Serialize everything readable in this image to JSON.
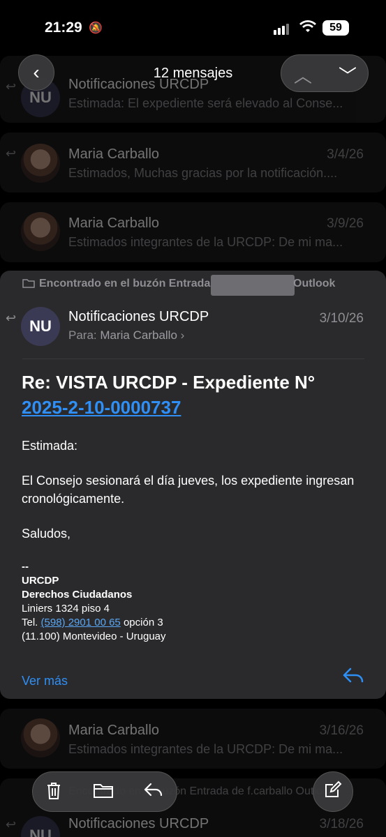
{
  "status_bar": {
    "time": "21:29",
    "battery": "59"
  },
  "nav": {
    "title": "12 mensajes"
  },
  "messages_above": [
    {
      "sender": "Notificaciones URCDP",
      "initials": "NU",
      "preview": "Estimada: El expediente será elevado al Conse...",
      "date": ""
    },
    {
      "sender": "Maria Carballo",
      "preview": "Estimados, Muchas gracias por la notificación....",
      "date": "3/4/26"
    },
    {
      "sender": "Maria Carballo",
      "preview": "Estimados integrantes de la URCDP: De mi ma...",
      "date": "3/9/26"
    }
  ],
  "main_message": {
    "found_in_prefix": "Encontrado en el buzón Entrada",
    "found_in_suffix": "Outlook",
    "initials": "NU",
    "sender": "Notificaciones URCDP",
    "date": "3/10/26",
    "to_label": "Para:",
    "to_name": "Maria Carballo",
    "subject_prefix": "Re: VISTA URCDP - Expediente N°",
    "subject_link": "2025-2-10-0000737",
    "greeting": "Estimada:",
    "body": "El Consejo sesionará el día jueves, los expediente ingresan cronológicamente.",
    "closing": "Saludos,",
    "sig_dash": "--",
    "sig_org": "URCDP",
    "sig_dept": "Derechos Ciudadanos",
    "sig_address": "Liniers 1324 piso 4",
    "sig_tel_label": "Tel.",
    "sig_tel": "(598) 2901 00 65",
    "sig_tel_suffix": "opción 3",
    "sig_city": "(11.100) Montevideo - Uruguay",
    "see_more": "Ver más"
  },
  "messages_below": [
    {
      "sender": "Maria Carballo",
      "preview": "Estimados integrantes de la URCDP: De mi ma...",
      "date": "3/16/26"
    },
    {
      "found_in": "Encontrado en el buzón Entrada de f.carballo Outlook",
      "sender": "Notificaciones URCDP",
      "initials": "NU",
      "date": "3/18/26"
    }
  ]
}
